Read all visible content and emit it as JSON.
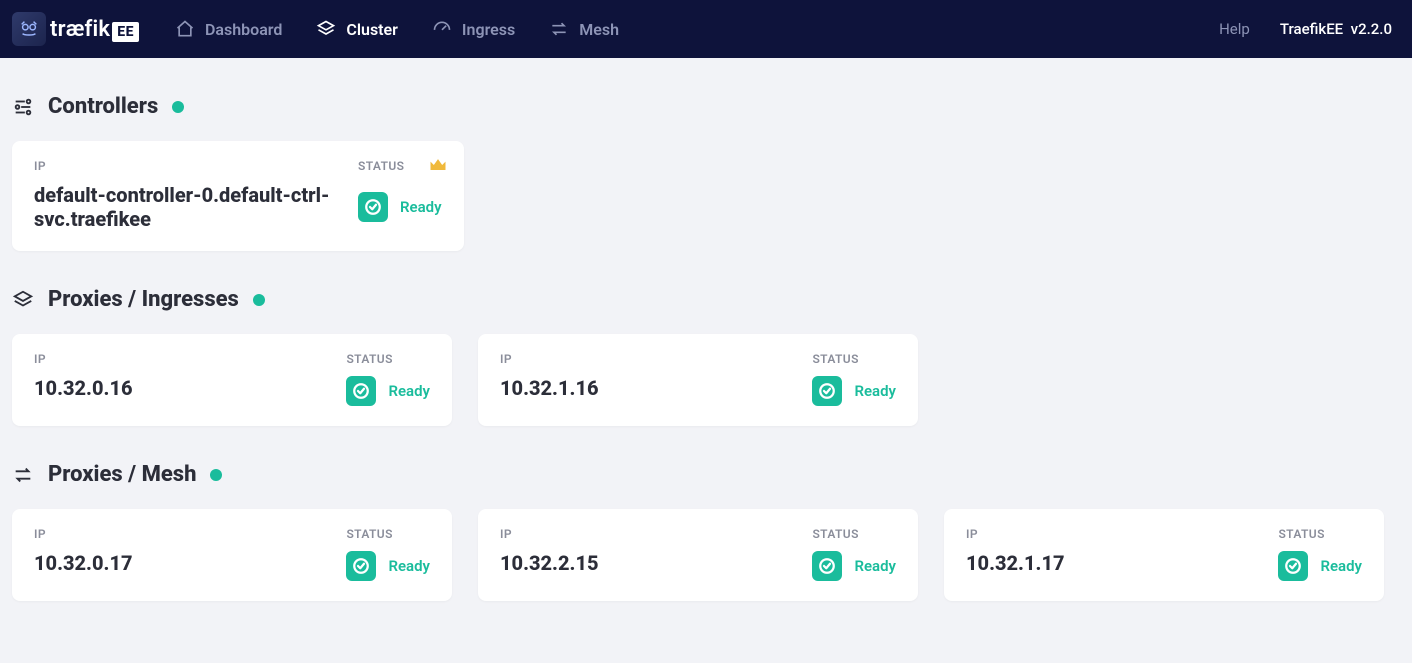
{
  "brand": {
    "name": "træfik",
    "suffix": "EE"
  },
  "nav": {
    "dashboard": "Dashboard",
    "cluster": "Cluster",
    "ingress": "Ingress",
    "mesh": "Mesh",
    "active": "cluster"
  },
  "header": {
    "help": "Help",
    "product": "TraefikEE",
    "version": "v2.2.0"
  },
  "labels": {
    "ip": "IP",
    "status": "STATUS",
    "ready": "Ready"
  },
  "sections": {
    "controllers": {
      "title": "Controllers",
      "items": [
        {
          "ip": "default-controller-0.default-ctrl-svc.traefikee",
          "status": "Ready",
          "leader": true
        }
      ]
    },
    "proxies_ingresses": {
      "title": "Proxies / Ingresses",
      "items": [
        {
          "ip": "10.32.0.16",
          "status": "Ready"
        },
        {
          "ip": "10.32.1.16",
          "status": "Ready"
        }
      ]
    },
    "proxies_mesh": {
      "title": "Proxies / Mesh",
      "items": [
        {
          "ip": "10.32.0.17",
          "status": "Ready"
        },
        {
          "ip": "10.32.2.15",
          "status": "Ready"
        },
        {
          "ip": "10.32.1.17",
          "status": "Ready"
        }
      ]
    }
  }
}
